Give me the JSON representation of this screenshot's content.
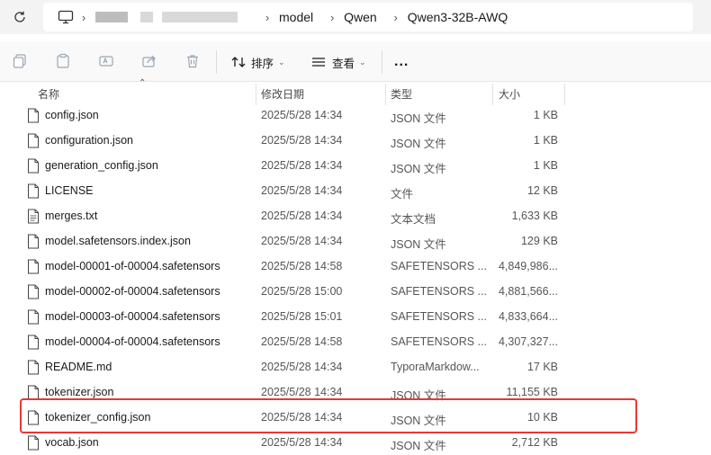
{
  "address_bar": {
    "refresh_icon": "refresh-icon",
    "pc_icon": "computer-icon",
    "breadcrumbs": [
      "model",
      "Qwen",
      "Qwen3-32B-AWQ"
    ]
  },
  "toolbar": {
    "sort_label": "排序",
    "view_label": "查看",
    "more_label": "..."
  },
  "columns": {
    "name": "名称",
    "date": "修改日期",
    "type": "类型",
    "size": "大小"
  },
  "files": [
    {
      "name": "config.json",
      "date": "2025/5/28 14:34",
      "type": "JSON 文件",
      "size": "1 KB"
    },
    {
      "name": "configuration.json",
      "date": "2025/5/28 14:34",
      "type": "JSON 文件",
      "size": "1 KB"
    },
    {
      "name": "generation_config.json",
      "date": "2025/5/28 14:34",
      "type": "JSON 文件",
      "size": "1 KB"
    },
    {
      "name": "LICENSE",
      "date": "2025/5/28 14:34",
      "type": "文件",
      "size": "12 KB"
    },
    {
      "name": "merges.txt",
      "date": "2025/5/28 14:34",
      "type": "文本文档",
      "size": "1,633 KB"
    },
    {
      "name": "model.safetensors.index.json",
      "date": "2025/5/28 14:34",
      "type": "JSON 文件",
      "size": "129 KB"
    },
    {
      "name": "model-00001-of-00004.safetensors",
      "date": "2025/5/28 14:58",
      "type": "SAFETENSORS ...",
      "size": "4,849,986..."
    },
    {
      "name": "model-00002-of-00004.safetensors",
      "date": "2025/5/28 15:00",
      "type": "SAFETENSORS ...",
      "size": "4,881,566..."
    },
    {
      "name": "model-00003-of-00004.safetensors",
      "date": "2025/5/28 15:01",
      "type": "SAFETENSORS ...",
      "size": "4,833,664..."
    },
    {
      "name": "model-00004-of-00004.safetensors",
      "date": "2025/5/28 14:58",
      "type": "SAFETENSORS ...",
      "size": "4,307,327..."
    },
    {
      "name": "README.md",
      "date": "2025/5/28 14:34",
      "type": "TyporaMarkdow...",
      "size": "17 KB"
    },
    {
      "name": "tokenizer.json",
      "date": "2025/5/28 14:34",
      "type": "JSON 文件",
      "size": "11,155 KB"
    },
    {
      "name": "tokenizer_config.json",
      "date": "2025/5/28 14:34",
      "type": "JSON 文件",
      "size": "10 KB"
    },
    {
      "name": "vocab.json",
      "date": "2025/5/28 14:34",
      "type": "JSON 文件",
      "size": "2,712 KB"
    }
  ],
  "highlight_color": "#e53935"
}
